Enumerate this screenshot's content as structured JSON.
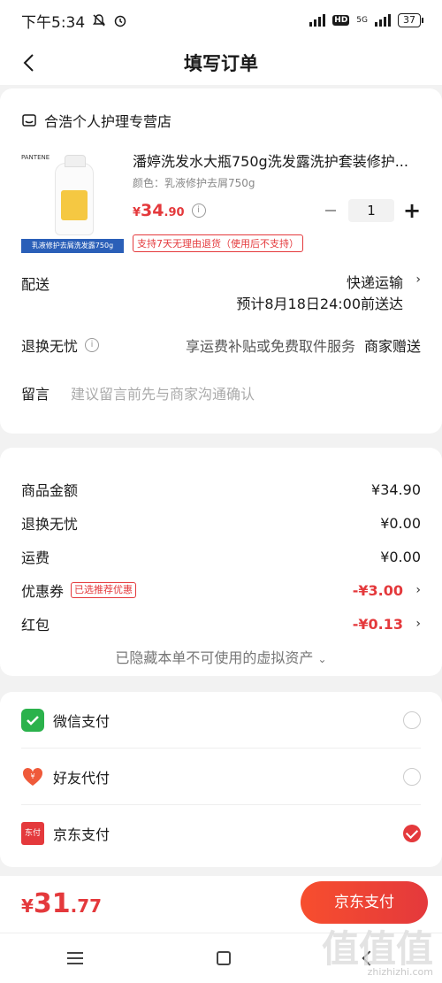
{
  "status_bar": {
    "time": "下午5:34",
    "network": "5G",
    "hd": "HD",
    "battery": "37"
  },
  "nav": {
    "title": "填写订单"
  },
  "shop": {
    "name": "合浩个人护理专营店",
    "icon": "store-icon"
  },
  "product": {
    "brand": "PANTENE",
    "image_caption": "乳液修护去屑洗发露750g",
    "name": "潘婷洗发水大瓶750g洗发露洗护套装修护...",
    "spec": "颜色：乳液修护去屑750g",
    "price_currency": "¥",
    "price_int": "34",
    "price_dec": ".90",
    "quantity": "1",
    "return_tag": "支持7天无理由退货（使用后不支持）"
  },
  "delivery": {
    "label": "配送",
    "method": "快递运输",
    "eta": "预计8月18日24:00前送达"
  },
  "refund": {
    "label": "退换无忧",
    "desc": "享运费补贴或免费取件服务",
    "gift": "商家赠送"
  },
  "message": {
    "label": "留言",
    "placeholder": "建议留言前先与商家沟通确认"
  },
  "summary": {
    "goods_label": "商品金额",
    "goods_value": "¥34.90",
    "refund_label": "退换无忧",
    "refund_value": "¥0.00",
    "shipping_label": "运费",
    "shipping_value": "¥0.00",
    "coupon_label": "优惠券",
    "coupon_tag": "已选推荐优惠",
    "coupon_value": "-¥3.00",
    "redpacket_label": "红包",
    "redpacket_value": "-¥0.13",
    "hidden_note": "已隐藏本单不可使用的虚拟资产"
  },
  "payment": {
    "options": [
      {
        "label": "微信支付",
        "icon": "wechat-pay-icon",
        "selected": false
      },
      {
        "label": "好友代付",
        "icon": "friend-pay-icon",
        "selected": false
      },
      {
        "label": "京东支付",
        "icon": "jd-pay-icon",
        "selected": true
      }
    ],
    "jd_icon_text": "东付"
  },
  "footer": {
    "currency": "¥",
    "total_int": "31",
    "total_dec": ".77",
    "pay_button": "京东支付"
  },
  "watermark": {
    "text": "值值值",
    "site": "zhizhizhi.com"
  },
  "colors": {
    "accent": "#e4393c",
    "wechat": "#2bb24c",
    "background": "#f2f2f2"
  }
}
